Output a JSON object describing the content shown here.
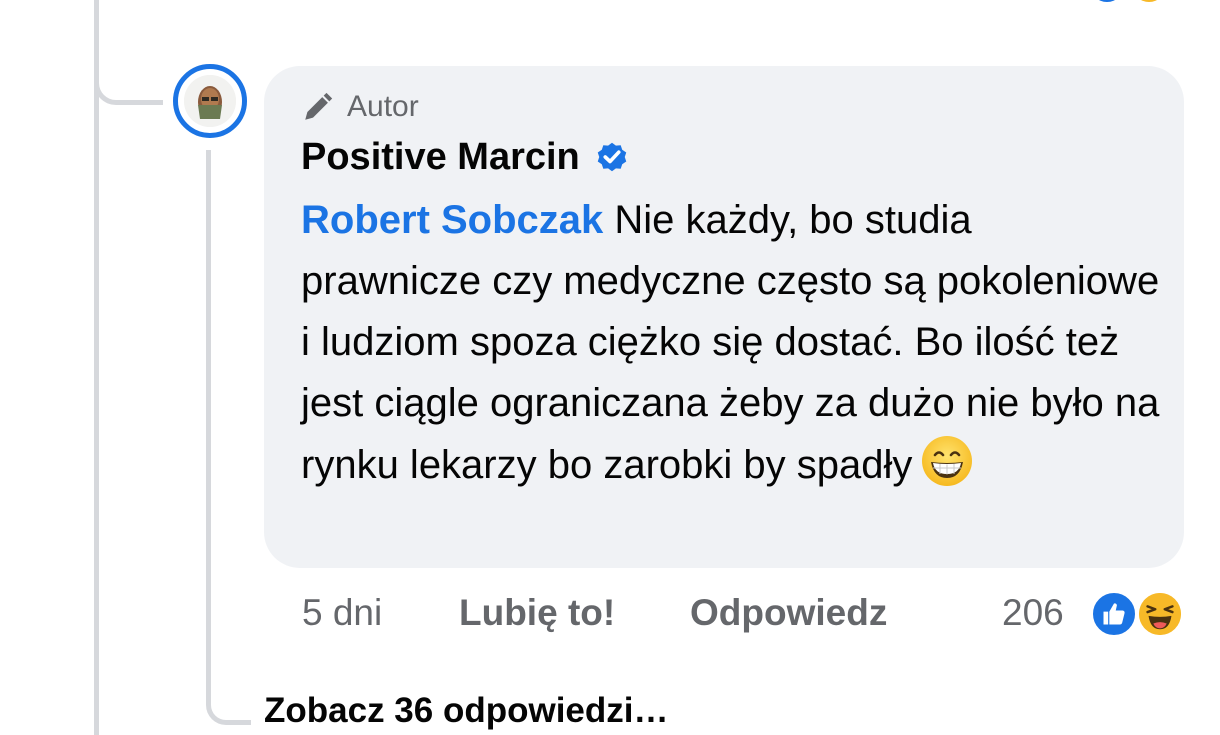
{
  "comment": {
    "author_badge": "Autor",
    "author_name": "Positive Marcin",
    "mention": "Robert Sobczak",
    "text": " Nie każdy, bo studia prawnicze czy medyczne często są pokoleniowe i ludziom spoza ciężko się dostać.  Bo ilość też jest ciągle ograniczana żeby za dużo nie było na rynku lekarzy bo zarobki by spadły"
  },
  "actions": {
    "timestamp": "5 dni",
    "like_label": "Lubię to!",
    "reply_label": "Odpowiedz",
    "reaction_count": "206"
  },
  "view_replies_label": "Zobacz 36 odpowiedzi…",
  "icons": {
    "author_badge": "pen-icon",
    "verified": "verified-badge-icon",
    "emoji": "grinning-face-emoji",
    "reactions": [
      "like-reaction-icon",
      "haha-reaction-icon"
    ]
  },
  "colors": {
    "accent": "#1b74e4",
    "bubble_bg": "#f0f2f5",
    "secondary_text": "#65676b",
    "primary_text": "#050505"
  }
}
